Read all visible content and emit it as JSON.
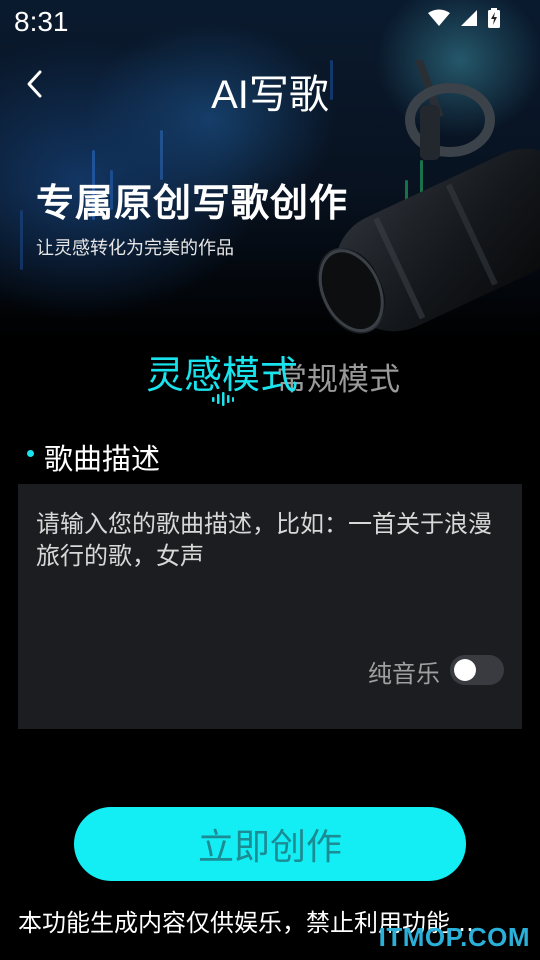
{
  "status_bar": {
    "time": "8:31",
    "icons": [
      "wifi-icon",
      "signal-icon",
      "battery-icon"
    ]
  },
  "header": {
    "back_icon": "chevron-left-icon",
    "title": "AI写歌"
  },
  "hero": {
    "headline": "专属原创写歌创作",
    "subline": "让灵感转化为完美的作品"
  },
  "mode_tabs": {
    "active": "灵感模式",
    "inactive": "常规模式"
  },
  "description_section": {
    "label": "歌曲描述",
    "placeholder": "请输入您的歌曲描述，比如：一首关于浪漫旅行的歌，女声",
    "pure_music_label": "纯音乐",
    "pure_music_enabled": false
  },
  "create_button": {
    "label": "立即创作"
  },
  "disclaimer": "本功能生成内容仅供娱乐，禁止利用功能…",
  "watermark": "ITMOP.COM",
  "colors": {
    "accent": "#19e3ec",
    "button_bg": "#12eef4",
    "button_text": "#1b8b94",
    "box_bg": "#1c1d21",
    "background": "#000000"
  }
}
